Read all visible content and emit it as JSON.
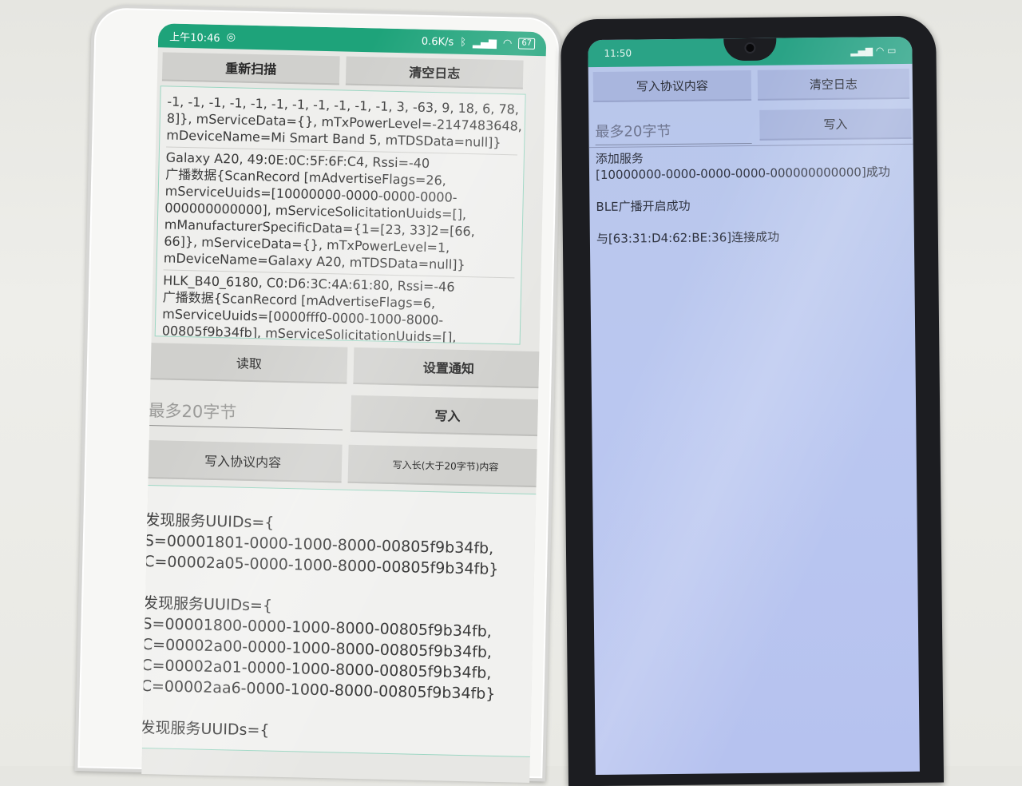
{
  "left_phone": {
    "status_time": "上午10:46",
    "status_net": "0.6K/s",
    "status_battery": "67",
    "buttons": {
      "rescan": "重新扫描",
      "clear_log": "清空日志",
      "read": "读取",
      "set_notify": "设置通知",
      "write": "写入",
      "write_protocol": "写入协议内容",
      "write_long": "写入长(大于20字节)内容"
    },
    "input_placeholder": "最多20字节",
    "scan_log": [
      [
        "-1, -1, -1, -1, -1, -1, -1, -1, -1, -1, -1, 3, -63, 9, 18, 6, 78,",
        "8]}, mServiceData={}, mTxPowerLevel=-2147483648,",
        "mDeviceName=Mi Smart Band 5, mTDSData=null]}"
      ],
      [
        "Galaxy A20, 49:0E:0C:5F:6F:C4, Rssi=-40",
        "广播数据{ScanRecord [mAdvertiseFlags=26,",
        "mServiceUuids=[10000000-0000-0000-0000-",
        "000000000000], mServiceSolicitationUuids=[],",
        "mManufacturerSpecificData={1=[23, 33]2=[66,",
        "66]}, mServiceData={}, mTxPowerLevel=1,",
        "mDeviceName=Galaxy A20, mTDSData=null]}"
      ],
      [
        "HLK_B40_6180, C0:D6:3C:4A:61:80, Rssi=-46",
        "广播数据{ScanRecord [mAdvertiseFlags=6,",
        "mServiceUuids=[0000fff0-0000-1000-8000-",
        "00805f9b34fb], mServiceSolicitationUuids=[],"
      ]
    ],
    "service_log": [
      "发现服务UUIDs={",
      "S=00001801-0000-1000-8000-00805f9b34fb,",
      "C=00002a05-0000-1000-8000-00805f9b34fb}",
      "",
      "发现服务UUIDs={",
      "S=00001800-0000-1000-8000-00805f9b34fb,",
      "C=00002a00-0000-1000-8000-00805f9b34fb,",
      "C=00002a01-0000-1000-8000-00805f9b34fb,",
      "C=00002aa6-0000-1000-8000-00805f9b34fb}",
      "",
      "发现服务UUIDs={"
    ]
  },
  "right_phone": {
    "status_time": "11:50",
    "buttons": {
      "write_protocol": "写入协议内容",
      "clear_log": "清空日志",
      "write": "写入"
    },
    "input_placeholder": "最多20字节",
    "log": [
      "添加服务",
      "[10000000-0000-0000-0000-000000000000]成功",
      "",
      "BLE广播开启成功",
      "",
      "与[63:31:D4:62:BE:36]连接成功"
    ]
  }
}
